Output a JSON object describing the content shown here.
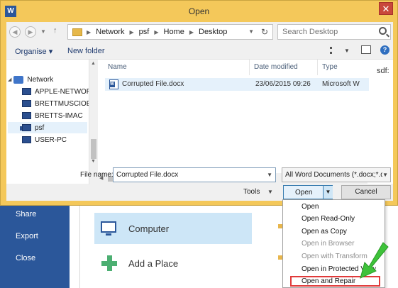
{
  "dialog": {
    "title": "Open",
    "close_glyph": "✕",
    "app_icon_letter": "W"
  },
  "address_bar": {
    "crumbs": [
      "Network",
      "psf",
      "Home",
      "Desktop"
    ],
    "search_placeholder": "Search Desktop"
  },
  "commands": {
    "organise": "Organise ▾",
    "new_folder": "New folder",
    "help": "?"
  },
  "nav_tree": {
    "root": "Network",
    "items": [
      "APPLE-NETWOR",
      "BRETTMUSCIOE",
      "BRETTS-IMAC",
      "psf",
      "USER-PC"
    ]
  },
  "file_list": {
    "columns": [
      "Name",
      "Date modified",
      "Type"
    ],
    "rows": [
      {
        "name": "Corrupted File.docx",
        "date": "23/06/2015 09:26",
        "type": "Microsoft W"
      }
    ]
  },
  "preview": {
    "text": "sdf:"
  },
  "footer": {
    "file_name_label": "File name:",
    "file_name_value": "Corrupted File.docx",
    "filter": "All Word Documents (*.docx;*.d",
    "tools": "Tools",
    "open": "Open",
    "cancel": "Cancel"
  },
  "open_menu": {
    "items": [
      {
        "label": "Open",
        "enabled": true
      },
      {
        "label": "Open Read-Only",
        "enabled": true
      },
      {
        "label": "Open as Copy",
        "enabled": true
      },
      {
        "label": "Open in Browser",
        "enabled": false
      },
      {
        "label": "Open with Transform",
        "enabled": false
      },
      {
        "label": "Open in Protected View",
        "enabled": true
      },
      {
        "label": "Open and Repair",
        "enabled": true
      }
    ],
    "highlight_color": "#e03a3a"
  },
  "backstage": {
    "left_items": [
      "Share",
      "Export",
      "Close"
    ],
    "places": [
      "Computer",
      "Add a Place"
    ],
    "accent": "#2b579a"
  },
  "colors": {
    "dialog_frame": "#f4c85a",
    "selection": "#e5f1fb",
    "arrow": "#3ec23a"
  }
}
